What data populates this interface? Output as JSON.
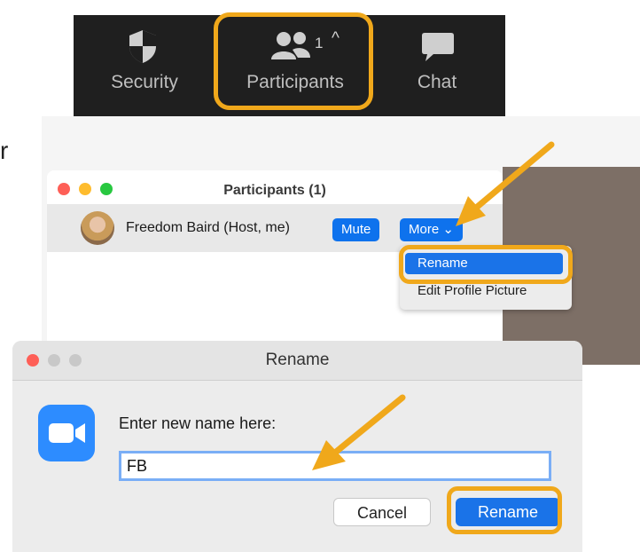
{
  "toolbar": {
    "security_label": "Security",
    "participants_label": "Participants",
    "participants_count": "1",
    "participants_caret": "^",
    "chat_label": "Chat"
  },
  "stray_text": "r",
  "participants_window": {
    "title": "Participants (1)",
    "participant_name": "Freedom Baird (Host, me)",
    "mute_label": "Mute",
    "more_label": "More",
    "more_caret": "⌄",
    "menu": {
      "rename": "Rename",
      "edit_profile_picture": "Edit Profile Picture"
    }
  },
  "rename_dialog": {
    "title": "Rename",
    "prompt": "Enter new name here:",
    "input_value": "FB",
    "cancel_label": "Cancel",
    "rename_label": "Rename"
  },
  "colors": {
    "highlight": "#f0a81b",
    "zoom_blue": "#2d8cff",
    "button_blue": "#1a73e8",
    "toolbar_bg": "#1f1f1f"
  },
  "icons": [
    "shield-icon",
    "participants-icon",
    "chat-icon",
    "zoom-camera-icon"
  ]
}
